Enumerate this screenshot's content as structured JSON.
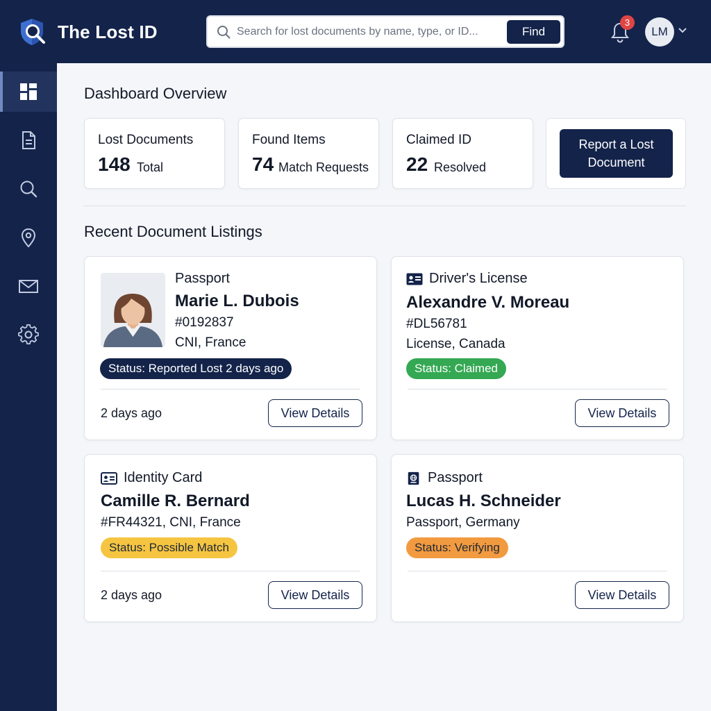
{
  "app": {
    "title": "The Lost ID"
  },
  "search": {
    "placeholder": "Search for lost documents by name, type, or ID...",
    "value": "",
    "button_label": "Find"
  },
  "notifications": {
    "count": "3"
  },
  "user": {
    "initials": "LM"
  },
  "sidebar": {
    "items": [
      {
        "name": "dashboard",
        "icon": "dashboard-icon",
        "active": true
      },
      {
        "name": "documents",
        "icon": "document-icon",
        "active": false
      },
      {
        "name": "search",
        "icon": "search-icon",
        "active": false
      },
      {
        "name": "locations",
        "icon": "location-pin-icon",
        "active": false
      },
      {
        "name": "messages",
        "icon": "mail-icon",
        "active": false
      },
      {
        "name": "settings",
        "icon": "gear-icon",
        "active": false
      }
    ]
  },
  "dashboard": {
    "title": "Dashboard Overview",
    "stats": [
      {
        "label": "Lost Documents",
        "value": "148",
        "suffix": "Total"
      },
      {
        "label": "Found Items",
        "value": "74",
        "suffix": "Match Requests"
      },
      {
        "label": "Claimed ID",
        "value": "22",
        "suffix": "Resolved"
      }
    ],
    "report_button": "Report a Lost Document"
  },
  "listings": {
    "title": "Recent Document Listings",
    "cards": [
      {
        "type": "Passport",
        "name": "Marie L. Dubois",
        "id_line": "#0192837",
        "detail_line": "CNI, France",
        "status": "Status: Reported Lost 2 days ago",
        "time": "2 days ago",
        "button": "View Details"
      },
      {
        "type": "Driver's License",
        "name": "Alexandre V. Moreau",
        "id_line": "#DL56781",
        "detail_line": "License, Canada",
        "status": "Status: Claimed",
        "time": "",
        "button": "View Details"
      },
      {
        "type": "Identity Card",
        "name": "Camille R. Bernard",
        "id_line": "#FR44321, CNI, France",
        "status": "Status: Possible Match",
        "time": "2 days ago",
        "button": "View Details"
      },
      {
        "type": "Passport",
        "name": "Lucas H. Schneider",
        "id_line": "Passport, Germany",
        "status": "Status: Verifying",
        "time": "",
        "button": "View Details"
      }
    ]
  },
  "colors": {
    "navy": "#13234a",
    "status_lost": "#13234a",
    "status_claimed": "#34a853",
    "status_possible_match": "#f5c542",
    "status_verifying": "#f29a3f",
    "notification_badge": "#e04545"
  }
}
